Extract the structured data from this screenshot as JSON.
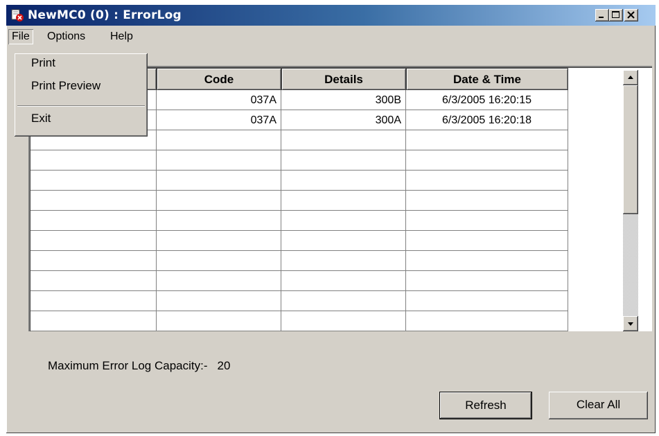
{
  "window": {
    "title": "NewMC0 (0) : ErrorLog",
    "title_bar_color": "#0a246a",
    "icon": "error-log-icon"
  },
  "menubar": {
    "items": [
      "File",
      "Options",
      "Help"
    ]
  },
  "file_menu": {
    "items": [
      "Print",
      "Print Preview",
      "Exit"
    ]
  },
  "table": {
    "columns": [
      "",
      "Code",
      "Details",
      "Date & Time"
    ],
    "rows": [
      {
        "code": "037A",
        "details": "300B",
        "datetime": "6/3/2005 16:20:15"
      },
      {
        "code": "037A",
        "details": "300A",
        "datetime": "6/3/2005 16:20:18"
      }
    ],
    "empty_rows": 10
  },
  "capacity": {
    "label": "Maximum Error Log Capacity:-",
    "value": "20"
  },
  "buttons": {
    "refresh": "Refresh",
    "clear_all": "Clear All"
  }
}
